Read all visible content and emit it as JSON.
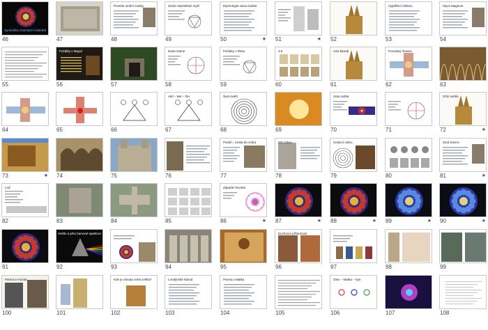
{
  "slides": [
    {
      "n": "46",
      "title": "Symbolika Gotických Katedrál",
      "style": "dark",
      "star": false
    },
    {
      "n": "47",
      "style": "relief",
      "star": false
    },
    {
      "n": "48",
      "title": "Ponetie umění Gotiky",
      "style": "bul-img",
      "star": false
    },
    {
      "n": "49",
      "title": "Znalci stavitelské myšl",
      "style": "diagram",
      "star": false
    },
    {
      "n": "50",
      "title": "Etymologie slova Gotika",
      "style": "bullets",
      "star": true
    },
    {
      "n": "51",
      "style": "sketch",
      "star": true
    },
    {
      "n": "52",
      "style": "cathedral",
      "star": false
    },
    {
      "n": "53",
      "title": "Vyjádření Ohlenu",
      "style": "bullets",
      "star": false
    },
    {
      "n": "54",
      "title": "Opus Magnum",
      "style": "bul-img",
      "star": false
    },
    {
      "n": "55",
      "style": "text",
      "star": false
    },
    {
      "n": "56",
      "title": "Počátky v Mayal",
      "style": "dark-bul",
      "star": false
    },
    {
      "n": "57",
      "style": "photo-green",
      "star": false
    },
    {
      "n": "58",
      "title": "Notre Dame",
      "style": "geom",
      "star": false
    },
    {
      "n": "59",
      "title": "Počátky v Řeku",
      "style": "diagram",
      "star": false
    },
    {
      "n": "60",
      "title": "4:0",
      "style": "icons",
      "star": false
    },
    {
      "n": "61",
      "title": "Axis Mundi",
      "style": "cathedral",
      "star": false
    },
    {
      "n": "62",
      "title": "Posvátný čtverec",
      "style": "plan",
      "star": false
    },
    {
      "n": "63",
      "style": "vault",
      "star": false
    },
    {
      "n": "64",
      "style": "plan",
      "star": false
    },
    {
      "n": "65",
      "style": "plan-red",
      "star": false
    },
    {
      "n": "66",
      "style": "tree",
      "star": false
    },
    {
      "n": "67",
      "title": "Alef – Bet – Šin",
      "style": "tree",
      "star": false
    },
    {
      "n": "68",
      "title": "Šest světů",
      "style": "circles",
      "star": false
    },
    {
      "n": "69",
      "style": "glow",
      "star": false
    },
    {
      "n": "70",
      "title": "Ústa světla",
      "style": "rose-bar",
      "star": false
    },
    {
      "n": "71",
      "style": "geom",
      "star": false
    },
    {
      "n": "72",
      "title": "Oční světlo",
      "style": "cathedral",
      "star": true
    },
    {
      "n": "73",
      "style": "gargoyle",
      "star": true
    },
    {
      "n": "74",
      "style": "portal",
      "star": false
    },
    {
      "n": "75",
      "style": "facade",
      "star": false
    },
    {
      "n": "76",
      "style": "figure-text",
      "star": false
    },
    {
      "n": "77",
      "title": "Portál = Cesta do vnitra",
      "style": "text-img",
      "star": false
    },
    {
      "n": "78",
      "title": "Oči církev",
      "style": "arch",
      "star": false
    },
    {
      "n": "79",
      "title": "Cesta k vnitru",
      "style": "labyrinth",
      "star": false
    },
    {
      "n": "80",
      "style": "plans",
      "star": false
    },
    {
      "n": "81",
      "title": "Zrod Snivce",
      "style": "bul-img",
      "star": true
    },
    {
      "n": "82",
      "title": "Loď",
      "style": "bul-plan",
      "star": false
    },
    {
      "n": "83",
      "style": "aerial",
      "star": false
    },
    {
      "n": "84",
      "style": "aerial2",
      "star": false
    },
    {
      "n": "85",
      "style": "sheet",
      "star": false
    },
    {
      "n": "86",
      "title": "Západní Rozeta",
      "style": "rose-pink",
      "star": true
    },
    {
      "n": "87",
      "style": "rose",
      "star": true
    },
    {
      "n": "88",
      "style": "rose",
      "star": true
    },
    {
      "n": "89",
      "style": "rose-blue",
      "star": true
    },
    {
      "n": "90",
      "style": "rose-blue",
      "star": true
    },
    {
      "n": "91",
      "style": "rose",
      "star": false
    },
    {
      "n": "92",
      "title": "Světlo a jeho barevné spektrum",
      "style": "prism",
      "star": false
    },
    {
      "n": "93",
      "style": "rose-small",
      "star": false
    },
    {
      "n": "94",
      "style": "statues",
      "star": false
    },
    {
      "n": "95",
      "style": "painting",
      "star": false
    },
    {
      "n": "96",
      "title": "Duchovní přítomnost",
      "style": "mary",
      "star": false
    },
    {
      "n": "97",
      "style": "icons2",
      "star": false
    },
    {
      "n": "98",
      "style": "vertical",
      "star": false
    },
    {
      "n": "99",
      "style": "sculpture",
      "star": false
    },
    {
      "n": "100",
      "title": "Panna a mozaic",
      "style": "church",
      "star": false
    },
    {
      "n": "101",
      "style": "statue2",
      "star": false
    },
    {
      "n": "102",
      "title": "Kde je ohnuta ostrá světla?",
      "style": "face",
      "star": false
    },
    {
      "n": "103",
      "title": "Londýnské Národ",
      "style": "bullets",
      "star": false
    },
    {
      "n": "104",
      "title": "Panna a Matka",
      "style": "bullets",
      "star": false
    },
    {
      "n": "105",
      "style": "text",
      "star": false
    },
    {
      "n": "106",
      "title": "Otec – Matka – Syn",
      "style": "symbols",
      "star": false
    },
    {
      "n": "107",
      "style": "cosmic",
      "star": false
    },
    {
      "n": "108",
      "style": "text-light",
      "star": false
    }
  ]
}
